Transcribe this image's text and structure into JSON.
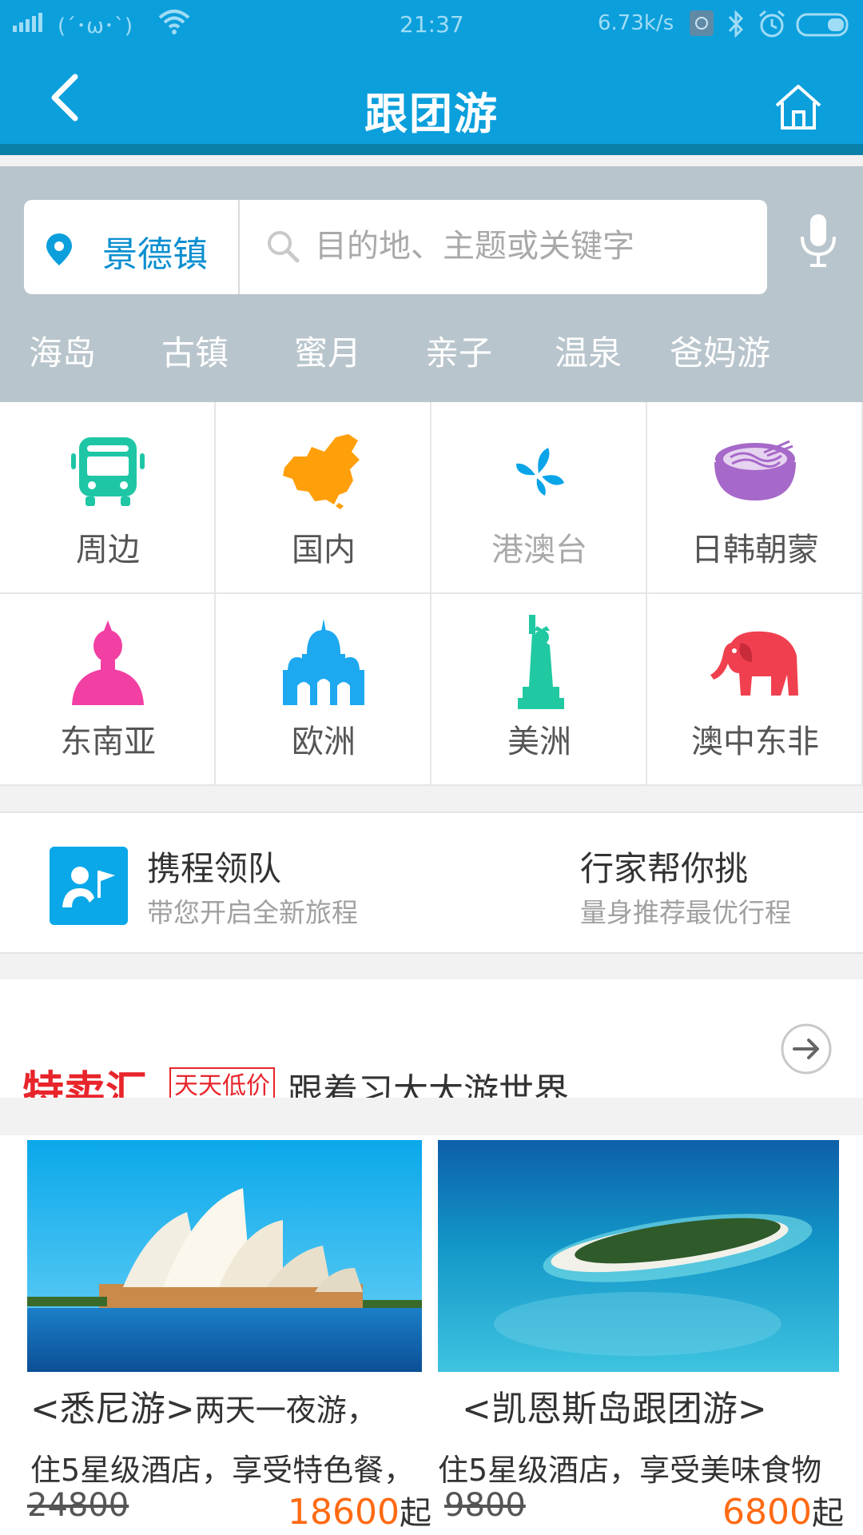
{
  "status_bar": {
    "face": "(´･ω･`)",
    "time": "21:37",
    "speed": "6.73k/s"
  },
  "header": {
    "title": "跟团游"
  },
  "search": {
    "city": "景德镇",
    "placeholder": "目的地、主题或关键字"
  },
  "hot_tags": [
    "海岛",
    "古镇",
    "蜜月",
    "亲子",
    "温泉",
    "爸妈游"
  ],
  "categories": [
    {
      "label": "周边",
      "icon": "bus-icon",
      "color": "#1fc6a6"
    },
    {
      "label": "国内",
      "icon": "china-map-icon",
      "color": "#ff9f0a"
    },
    {
      "label": "港澳台",
      "icon": "bauhinia-icon",
      "color": "#0aa4e8"
    },
    {
      "label": "日韩朝蒙",
      "icon": "ramen-bowl-icon",
      "color": "#a668c9"
    },
    {
      "label": "东南亚",
      "icon": "buddha-icon",
      "color": "#f23fa3"
    },
    {
      "label": "欧洲",
      "icon": "cathedral-icon",
      "color": "#1da8f0"
    },
    {
      "label": "美洲",
      "icon": "statue-of-liberty-icon",
      "color": "#20c9a2"
    },
    {
      "label": "澳中东非",
      "icon": "elephant-icon",
      "color": "#f0404f"
    }
  ],
  "leader": {
    "title": "携程领队",
    "subtitle": "带您开启全新旅程",
    "title2": "行家帮你挑",
    "subtitle2": "量身推荐最优行程"
  },
  "sale": {
    "brand": "特卖汇",
    "tag": "天天低价",
    "slogan": "跟着习大大游世界"
  },
  "products": [
    {
      "title": "<悉尼游>",
      "title_suffix": "两天一夜游，",
      "desc": "住5星级酒店，享受特色餐，",
      "old_price": "24800",
      "price": "18600",
      "price_suffix": "起"
    },
    {
      "title": "<凯恩斯岛跟团游>",
      "title_suffix": "",
      "desc": "住5星级酒店，享受美味食物",
      "old_price": "9800",
      "price": "6800",
      "price_suffix": "起"
    }
  ]
}
